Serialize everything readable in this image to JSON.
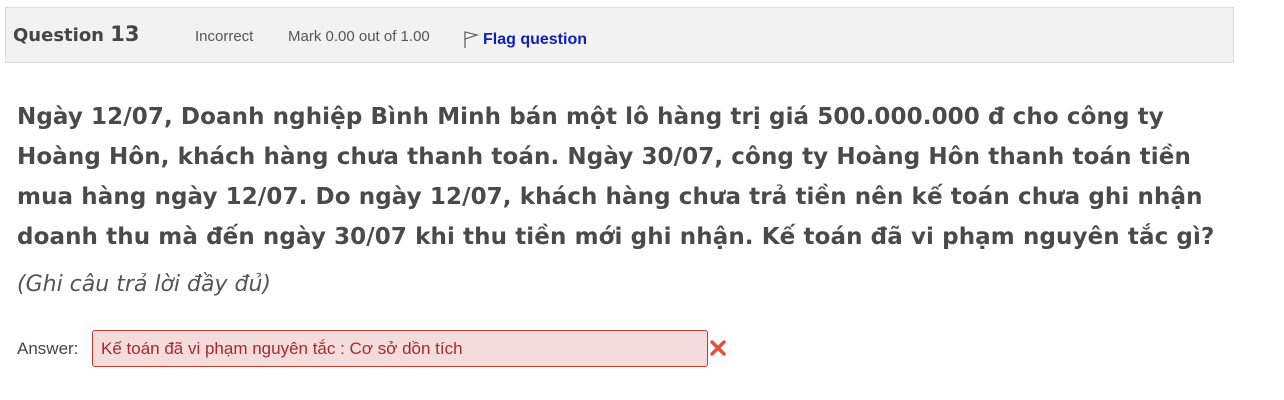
{
  "question": {
    "label": "Question",
    "number": "13",
    "state": "Incorrect",
    "grade": "Mark 0.00 out of 1.00",
    "flag_label": "Flag question",
    "text": "Ngày 12/07, Doanh nghiệp Bình Minh bán một lô hàng trị giá 500.000.000 đ cho công ty Hoàng Hôn, khách hàng chưa thanh toán. Ngày 30/07, công ty Hoàng Hôn thanh toán tiền mua hàng ngày 12/07. Do ngày 12/07, khách hàng chưa trả tiền nên kế toán chưa ghi nhận doanh thu mà đến ngày 30/07 khi thu tiền mới ghi nhận. Kế toán đã vi phạm nguyên tắc gì?",
    "hint": "(Ghi câu trả lời đầy đủ)"
  },
  "answer": {
    "label": "Answer:",
    "value": "Kế toán đã vi phạm nguyên tắc : Cơ sở dồn tích"
  },
  "icons": {
    "flag": "flag-icon",
    "incorrect": "incorrect-x-icon"
  },
  "colors": {
    "link": "#0f1fb8",
    "incorrect_border": "#c0392b",
    "incorrect_bg": "#f4dcdc",
    "incorrect_icon": "#e74c3c"
  }
}
